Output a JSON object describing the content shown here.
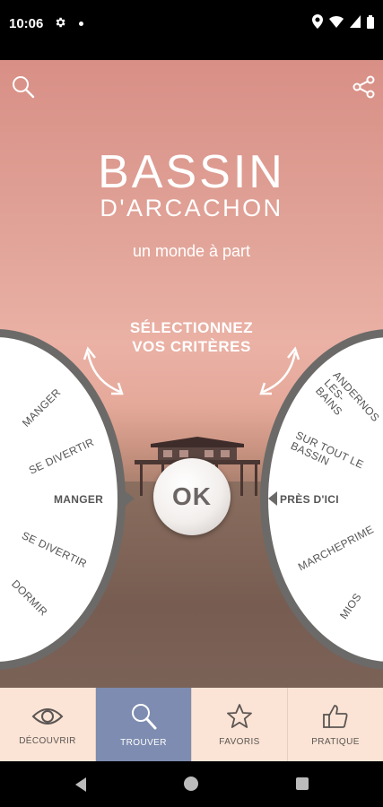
{
  "status_bar": {
    "time": "10:06"
  },
  "hero": {
    "title_line1": "BASSIN",
    "title_line2": "D'ARCACHON",
    "tagline": "un monde à part",
    "select_line1": "SÉLECTIONNEZ",
    "select_line2": "VOS CRITÈRES"
  },
  "wheel_left": {
    "items": [
      "MANGER",
      "SE DIVERTIR",
      "MANGER",
      "SE DIVERTIR",
      "DORMIR"
    ]
  },
  "wheel_right": {
    "items": [
      "ANDERNOS LES-BAINS",
      "SUR TOUT LE BASSIN",
      "PRÈS D'ICI",
      "MARCHEPRIME",
      "MIOS"
    ]
  },
  "ok_button": {
    "label": "OK"
  },
  "bottom_nav": {
    "items": [
      {
        "label": "DÉCOUVRIR",
        "icon": "eye-icon"
      },
      {
        "label": "TROUVER",
        "icon": "magnifier-icon",
        "active": true
      },
      {
        "label": "FAVORIS",
        "icon": "star-icon"
      },
      {
        "label": "PRATIQUE",
        "icon": "thumbs-up-icon"
      }
    ]
  },
  "colors": {
    "active_tab": "#7d8cb0",
    "nav_bg": "#fbe4d5",
    "wheel_border": "#6b6a68"
  }
}
